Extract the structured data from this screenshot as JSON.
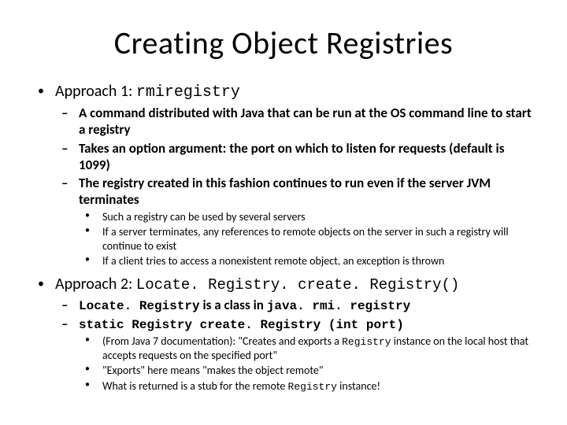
{
  "title": "Creating Object Registries",
  "approach1": {
    "heading_pre": "Approach 1:  ",
    "heading_code": "rmiregistry",
    "sub": [
      "A command distributed with Java that can be run at the OS command line to start a registry",
      "Takes an option argument:  the port on which to listen for requests (default is 1099)",
      "The registry created in this fashion continues to run even if the server JVM terminates"
    ],
    "subsub": [
      "Such a registry can be used by several servers",
      "If a server terminates, any references to remote objects on the server in such a registry will continue to exist",
      "If a client tries to access a nonexistent remote object, an exception is thrown"
    ]
  },
  "approach2": {
    "heading_pre": "Approach 2: ",
    "heading_code": "Locate. Registry. create. Registry()",
    "sub1_code1": "Locate. Registry",
    "sub1_mid": " is a class in ",
    "sub1_code2": "java. rmi. registry",
    "sub2_code": "static Registry create. Registry (int port)",
    "subsub1_pre": "(From Java 7 documentation):  \"Creates and exports a ",
    "subsub1_code": "Registry",
    "subsub1_post": " instance on the local host that accepts requests on the specified port\"",
    "subsub2": "\"Exports\" here means \"makes the object remote\"",
    "subsub3_pre": "What is returned is a stub for the remote ",
    "subsub3_code": "Registry",
    "subsub3_post": " instance!"
  }
}
